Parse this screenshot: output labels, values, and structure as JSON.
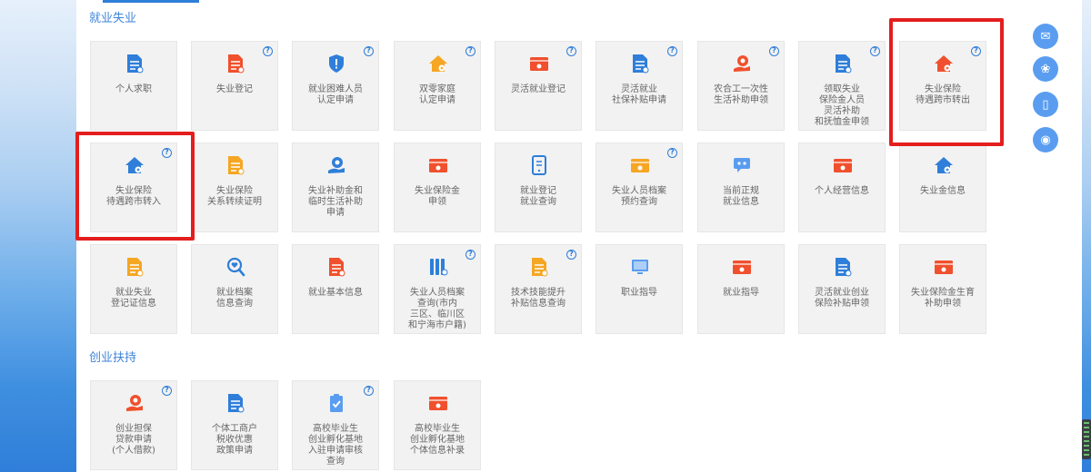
{
  "sections": {
    "employment": {
      "title": "就业失业"
    },
    "entrepreneurship": {
      "title": "创业扶持"
    }
  },
  "help_mark": "?",
  "tiles_row1": [
    {
      "label": "个人求职",
      "icon": "resume-doc-icon",
      "color": "#2f7ed9",
      "help": false
    },
    {
      "label": "失业登记",
      "icon": "briefcase-doc-icon",
      "color": "#f0502d",
      "help": true
    },
    {
      "label": "就业困难人员\n认定申请",
      "icon": "shield-alert-icon",
      "color": "#2f7ed9",
      "help": true
    },
    {
      "label": "双零家庭\n认定申请",
      "icon": "house-icon",
      "color": "#f5a623",
      "help": true
    },
    {
      "label": "灵活就业登记",
      "icon": "card-icon",
      "color": "#f0502d",
      "help": true
    },
    {
      "label": "灵活就业\n社保补贴申请",
      "icon": "doc-pen-icon",
      "color": "#2f7ed9",
      "help": true
    },
    {
      "label": "农合工一次性\n生活补助申领",
      "icon": "hand-coin-icon",
      "color": "#f0502d",
      "help": true
    },
    {
      "label": "领取失业\n保险金人员\n灵活补助\n和抚恤金申领",
      "icon": "doc-pen-icon",
      "color": "#2f7ed9",
      "help": true
    },
    {
      "label": "失业保险\n待遇跨市转出",
      "icon": "home-transfer-icon",
      "color": "#f0502d",
      "help": true
    }
  ],
  "tiles_row2": [
    {
      "label": "失业保险\n待遇跨市转入",
      "icon": "home-transfer-icon",
      "color": "#2f7ed9",
      "help": true
    },
    {
      "label": "失业保险\n关系转续证明",
      "icon": "briefcase-doc-icon",
      "color": "#f5a623",
      "help": false
    },
    {
      "label": "失业补助金和\n临时生活补助\n申请",
      "icon": "cloud-hand-icon",
      "color": "#2f7ed9",
      "help": false
    },
    {
      "label": "失业保险金\n申领",
      "icon": "card-icon",
      "color": "#f0502d",
      "help": false
    },
    {
      "label": "就业登记\n就业查询",
      "icon": "phone-doc-icon",
      "color": "#2f7ed9",
      "help": false
    },
    {
      "label": "失业人员档案\n预约查询",
      "icon": "card-icon",
      "color": "#f5a623",
      "help": true
    },
    {
      "label": "当前正规\n就业信息",
      "icon": "group-chat-icon",
      "color": "#5a9df0",
      "help": false
    },
    {
      "label": "个人经营信息",
      "icon": "id-card-icon",
      "color": "#f0502d",
      "help": false
    },
    {
      "label": "失业金信息",
      "icon": "home-transfer-icon",
      "color": "#2f7ed9",
      "help": false
    }
  ],
  "tiles_row3": [
    {
      "label": "就业失业\n登记证信息",
      "icon": "briefcase-doc-icon",
      "color": "#f5a623",
      "help": false
    },
    {
      "label": "就业档案\n信息查询",
      "icon": "magnifier-heart-icon",
      "color": "#2f7ed9",
      "help": false
    },
    {
      "label": "就业基本信息",
      "icon": "doc-lines-icon",
      "color": "#f0502d",
      "help": false
    },
    {
      "label": "失业人员档案\n查询(市内\n三区、临川区\n和宁海市户籍)",
      "icon": "binders-icon",
      "color": "#2f7ed9",
      "help": true
    },
    {
      "label": "技术技能提升\n补贴信息查询",
      "icon": "doc-coin-icon",
      "color": "#f5a623",
      "help": true
    },
    {
      "label": "职业指导",
      "icon": "monitor-icon",
      "color": "#5a9df0",
      "help": false
    },
    {
      "label": "就业指导",
      "icon": "board-icon",
      "color": "#f0502d",
      "help": false
    },
    {
      "label": "灵活就业创业\n保险补贴申领",
      "icon": "doc-pen-icon",
      "color": "#2f7ed9",
      "help": false
    },
    {
      "label": "失业保险金生育\n补助申领",
      "icon": "card-icon",
      "color": "#f0502d",
      "help": false
    }
  ],
  "tiles_row4": [
    {
      "label": "创业担保\n贷款申请\n(个人借款)",
      "icon": "hand-coin-icon",
      "color": "#f0502d",
      "help": true
    },
    {
      "label": "个体工商户\n税收优惠\n政策申请",
      "icon": "doc-pen-icon",
      "color": "#2f7ed9",
      "help": false
    },
    {
      "label": "高校毕业生\n创业孵化基地\n入驻申请审核\n查询",
      "icon": "clipboard-check-icon",
      "color": "#5a9df0",
      "help": true
    },
    {
      "label": "高校毕业生\n创业孵化基地\n个体信息补录",
      "icon": "card-icon",
      "color": "#f0502d",
      "help": false
    }
  ],
  "floating_toolbar": [
    {
      "icon": "wechat-icon",
      "glyph": "✉"
    },
    {
      "icon": "mini-program-icon",
      "glyph": "❀"
    },
    {
      "icon": "mobile-icon",
      "glyph": "▯"
    },
    {
      "icon": "gov-service-icon",
      "glyph": "◉"
    }
  ]
}
